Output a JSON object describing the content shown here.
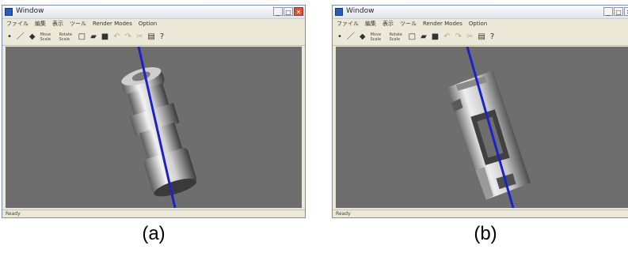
{
  "windows": [
    {
      "title": "Window",
      "menu": [
        "ファイル",
        "編集",
        "表示",
        "ツール",
        "Render Modes",
        "Option"
      ],
      "toolbar_text": [
        "Move",
        "Scale",
        "Rotate",
        "Scale"
      ],
      "status": "Ready",
      "caption": "(a)"
    },
    {
      "title": "Window",
      "menu": [
        "ファイル",
        "編集",
        "表示",
        "ツール",
        "Render Modes",
        "Option"
      ],
      "toolbar_text": [
        "Move",
        "Scale",
        "Rotate",
        "Scale"
      ],
      "status": "Ready",
      "caption": "(b)"
    }
  ],
  "icons": {
    "pointer": "pointer-icon",
    "pen": "pen-icon",
    "cube": "cube-icon",
    "new": "new-file-icon",
    "open": "open-folder-icon",
    "save": "save-icon",
    "undo": "undo-icon",
    "redo": "redo-icon",
    "print": "print-icon",
    "help": "help-icon"
  },
  "colors": {
    "viewport_bg": "#6e6e6e",
    "axis_line": "#1a22c8",
    "window_frame": "#ece9d8",
    "close_button": "#d9533a"
  }
}
